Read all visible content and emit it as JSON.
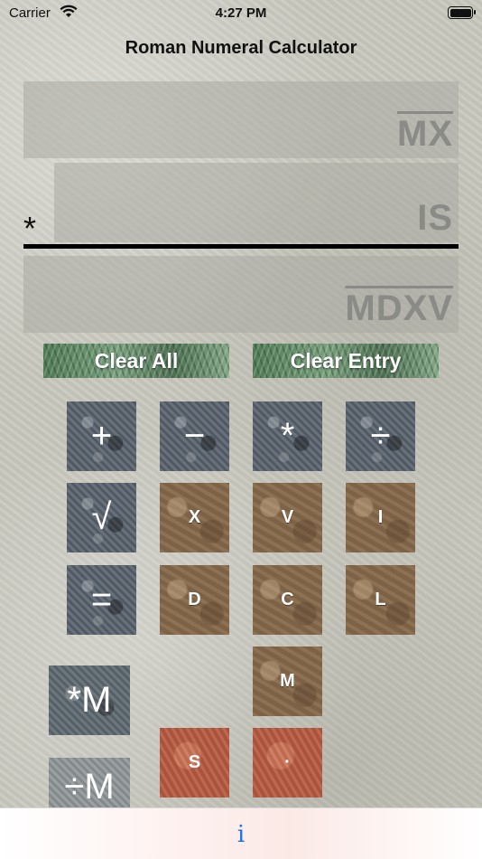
{
  "status_bar": {
    "carrier": "Carrier",
    "time": "4:27 PM"
  },
  "app": {
    "title": "Roman Numeral Calculator"
  },
  "display": {
    "top_value": "MX",
    "middle_value": "IS",
    "operator": "*",
    "result_value": "MDXV"
  },
  "buttons": {
    "clear_all": "Clear All",
    "clear_entry": "Clear Entry",
    "add": "+",
    "subtract": "−",
    "multiply": "*",
    "divide": "÷",
    "sqrt": "√",
    "equals": "=",
    "multiply_memory": "*M",
    "divide_memory": "÷M",
    "digit_x": "X",
    "digit_v": "V",
    "digit_i": "I",
    "digit_d": "D",
    "digit_c": "C",
    "digit_l": "L",
    "digit_m": "M",
    "digit_s": "S",
    "digit_dot": "·"
  },
  "tab_bar": {
    "info": "i"
  },
  "colors": {
    "accent": "#1a73e8",
    "divider": "#000000"
  }
}
